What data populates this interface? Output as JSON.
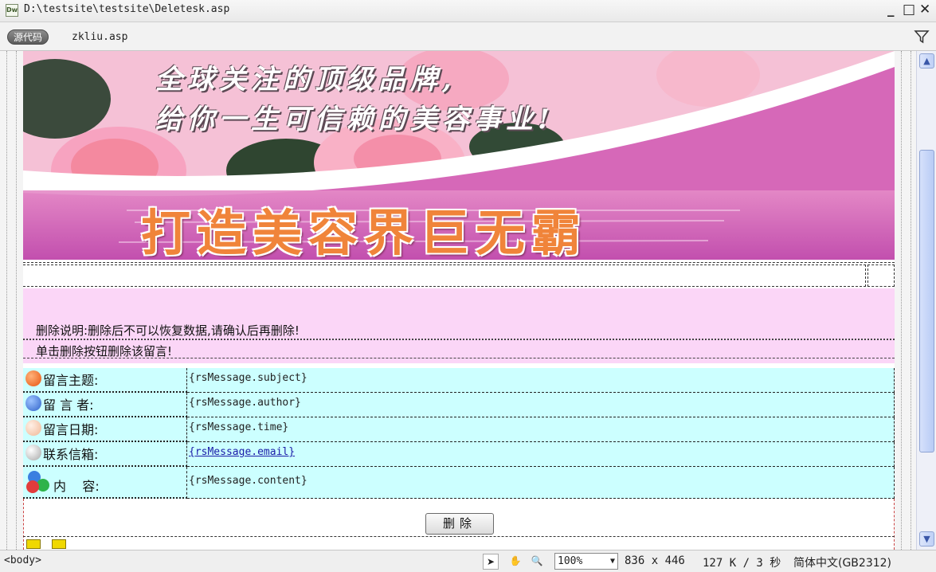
{
  "titlebar": {
    "path": "D:\\testsite\\testsite\\Deletesk.asp",
    "icon": "Dw",
    "minimize": "_",
    "maximize": "□",
    "close": "✕"
  },
  "toolbar": {
    "source_label": "源代码",
    "file_tab": "zkliu.asp"
  },
  "banner": {
    "slogan_line1": "全球关注的顶级品牌,",
    "slogan_line2": "给你一生可信赖的美容事业!",
    "headline": "打造美容界巨无霸"
  },
  "notice": {
    "line1": "删除说明:删除后不可以恢复数据,请确认后再删除!",
    "line2": "单击删除按钮删除该留言!"
  },
  "form": {
    "rows": [
      {
        "label": "留言主题:",
        "value": "{rsMessage.subject}",
        "icon": "orange-apple-icon",
        "color": "#f36b1c"
      },
      {
        "label": "留 言 者:",
        "value": "{rsMessage.author}",
        "icon": "blue-apple-icon",
        "color": "#3f7fd8"
      },
      {
        "label": "留言日期:",
        "value": "{rsMessage.time}",
        "icon": "peach-apple-icon",
        "color": "#f3c0a6"
      },
      {
        "label": "联系信箱:",
        "value": "{rsMessage.email}",
        "icon": "silver-apple-icon",
        "color": "#c8c8c8"
      },
      {
        "label": "内    容:",
        "value": "{rsMessage.content}",
        "icon": "colored-blocks-icon",
        "color": "#e23c3c"
      }
    ],
    "delete_label": "删除"
  },
  "statusbar": {
    "tag": "<body>",
    "zoom": "100%",
    "dimensions": "836 x 446",
    "size_time": "127 K / 3 秒",
    "encoding": "简体中文(GB2312)"
  }
}
